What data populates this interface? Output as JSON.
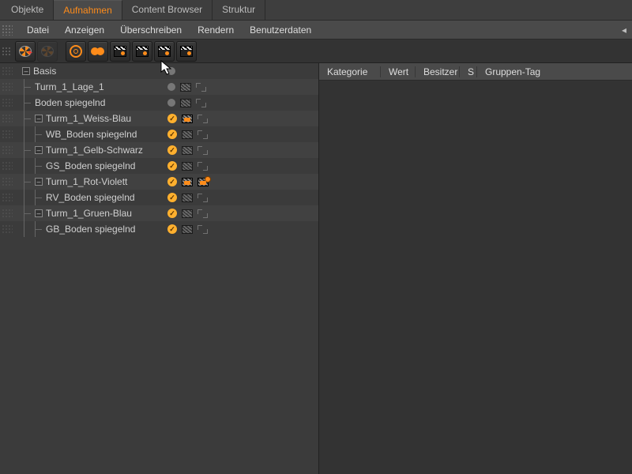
{
  "tabs": {
    "objects": "Objekte",
    "takes": "Aufnahmen",
    "content_browser": "Content Browser",
    "structure": "Struktur",
    "active": "takes"
  },
  "menu": {
    "file": "Datei",
    "view": "Anzeigen",
    "override": "Überschreiben",
    "render": "Rendern",
    "userdata": "Benutzerdaten",
    "arrow": "◂"
  },
  "toolbar_icons": [
    "new-take-icon",
    "new-child-take-icon",
    "auto-take-icon",
    "override-icon",
    "clapper-a-icon",
    "clapper-b-icon",
    "clapper-c-icon",
    "clapper-d-icon"
  ],
  "attr_headers": {
    "category": "Kategorie",
    "value": "Wert",
    "owner": "Besitzer",
    "s": "S",
    "group_tag": "Gruppen-Tag"
  },
  "expander_glyph": "–",
  "check_glyph": "✓",
  "tree": [
    {
      "label": "Basis",
      "depth": 0,
      "expandable": true,
      "status": [
        "dot"
      ],
      "alt": false
    },
    {
      "label": "Turm_1_Lage_1",
      "depth": 1,
      "expandable": false,
      "status": [
        "dot",
        "clap",
        "expand"
      ],
      "alt": true
    },
    {
      "label": "Boden spiegelnd",
      "depth": 1,
      "expandable": false,
      "status": [
        "dot",
        "clap",
        "expand"
      ],
      "alt": false
    },
    {
      "label": "Turm_1_Weiss-Blau",
      "depth": 1,
      "expandable": true,
      "status": [
        "check",
        "clap-hl",
        "expand"
      ],
      "alt": true
    },
    {
      "label": "WB_Boden spiegelnd",
      "depth": 2,
      "expandable": false,
      "status": [
        "check",
        "clap",
        "expand"
      ],
      "alt": false
    },
    {
      "label": "Turm_1_Gelb-Schwarz",
      "depth": 1,
      "expandable": true,
      "status": [
        "check",
        "clap",
        "expand"
      ],
      "alt": true
    },
    {
      "label": "GS_Boden spiegelnd",
      "depth": 2,
      "expandable": false,
      "status": [
        "check",
        "clap",
        "expand"
      ],
      "alt": false
    },
    {
      "label": "Turm_1_Rot-Violett",
      "depth": 1,
      "expandable": true,
      "status": [
        "check",
        "clap-hl",
        "expand-gear"
      ],
      "alt": true
    },
    {
      "label": "RV_Boden spiegelnd",
      "depth": 2,
      "expandable": false,
      "status": [
        "check",
        "clap",
        "expand"
      ],
      "alt": false
    },
    {
      "label": "Turm_1_Gruen-Blau",
      "depth": 1,
      "expandable": true,
      "status": [
        "check",
        "clap",
        "expand"
      ],
      "alt": true
    },
    {
      "label": "GB_Boden spiegelnd",
      "depth": 2,
      "expandable": false,
      "status": [
        "check",
        "clap",
        "expand"
      ],
      "alt": false
    }
  ]
}
